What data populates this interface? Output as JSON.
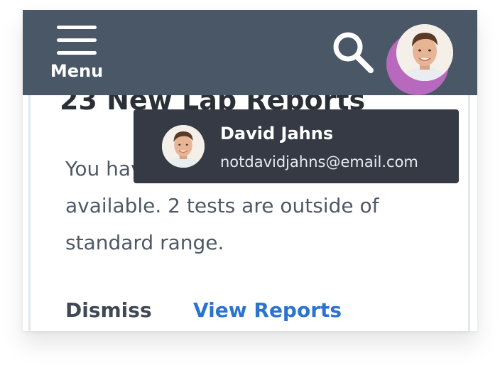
{
  "header": {
    "menu_label": "Menu",
    "search_icon": "search-icon",
    "avatar_icon": "user-avatar",
    "background": "#4a5767"
  },
  "card": {
    "title": "23 New Lab Reports",
    "body": "You have 23 new lab reports available. 2 tests are outside of standard range.",
    "dismiss_label": "Dismiss",
    "view_reports_label": "View Reports",
    "link_color": "#2a74d0"
  },
  "tooltip": {
    "name": "David Jahns",
    "email": "notdavidjahns@email.com",
    "background": "#353a45"
  },
  "highlight_color": "#cd6ccd"
}
